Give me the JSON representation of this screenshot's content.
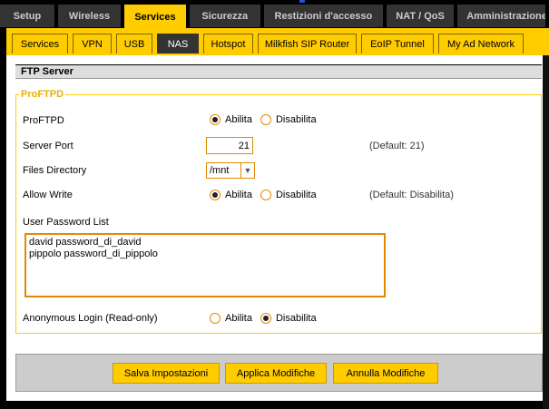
{
  "main_tabs": [
    {
      "label": "Setup",
      "active": false
    },
    {
      "label": "Wireless",
      "active": false
    },
    {
      "label": "Services",
      "active": true
    },
    {
      "label": "Sicurezza",
      "active": false
    },
    {
      "label": "Restizioni d'accesso",
      "active": false
    },
    {
      "label": "NAT / QoS",
      "active": false
    },
    {
      "label": "Amministrazione",
      "active": false
    }
  ],
  "sub_tabs": [
    {
      "label": "Services",
      "active": false
    },
    {
      "label": "VPN",
      "active": false
    },
    {
      "label": "USB",
      "active": false
    },
    {
      "label": "NAS",
      "active": true
    },
    {
      "label": "Hotspot",
      "active": false
    },
    {
      "label": "Milkfish SIP Router",
      "active": false
    },
    {
      "label": "EoIP Tunnel",
      "active": false
    },
    {
      "label": "My Ad Network",
      "active": false
    }
  ],
  "section": {
    "title": "FTP Server",
    "legend": "ProFTPD"
  },
  "form": {
    "proftpd": {
      "label": "ProFTPD",
      "enable": "Abilita",
      "disable": "Disabilita",
      "selected": "enable"
    },
    "server_port": {
      "label": "Server Port",
      "value": "21",
      "hint": "(Default: 21)"
    },
    "files_directory": {
      "label": "Files Directory",
      "value": "/mnt"
    },
    "allow_write": {
      "label": "Allow Write",
      "enable": "Abilita",
      "disable": "Disabilita",
      "selected": "enable",
      "hint": "(Default: Disabilita)"
    },
    "user_password_list": {
      "label": "User Password List",
      "value": "david password_di_david\npippolo password_di_pippolo"
    },
    "anonymous_login": {
      "label": "Anonymous Login (Read-only)",
      "enable": "Abilita",
      "disable": "Disabilita",
      "selected": "disable"
    }
  },
  "buttons": {
    "save": "Salva Impostazioni",
    "apply": "Applica Modifiche",
    "cancel": "Annulla Modifiche"
  },
  "colors": {
    "accent": "#ffcc00",
    "tab_inactive": "#333333",
    "input_border": "#e08a00"
  }
}
